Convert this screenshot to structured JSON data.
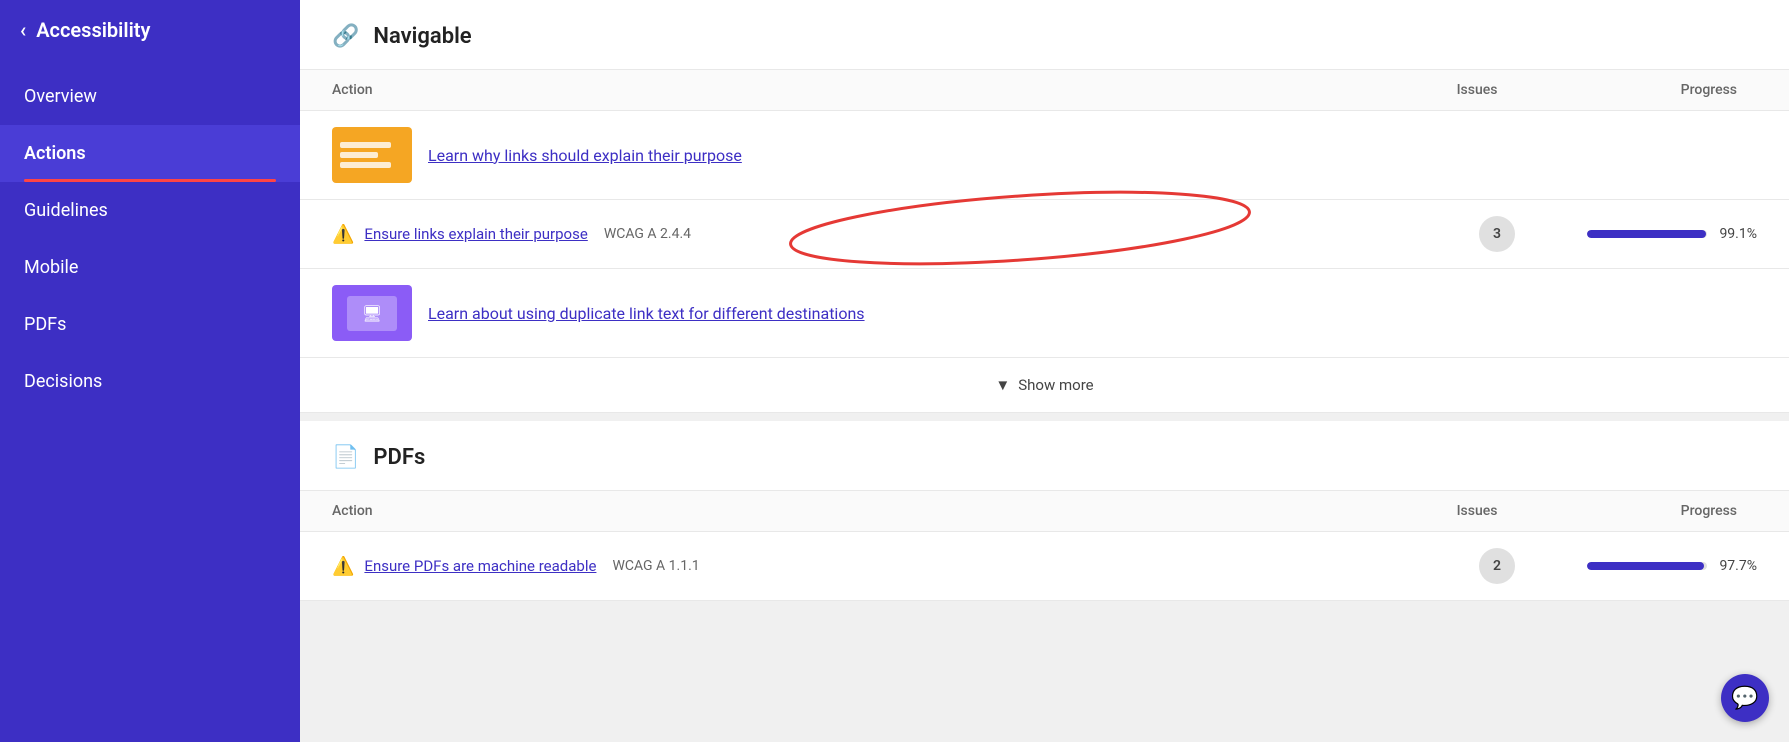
{
  "sidebar": {
    "title": "Accessibility",
    "back_label": "‹",
    "items": [
      {
        "id": "overview",
        "label": "Overview",
        "active": false
      },
      {
        "id": "actions",
        "label": "Actions",
        "active": true
      },
      {
        "id": "guidelines",
        "label": "Guidelines",
        "active": false
      },
      {
        "id": "mobile",
        "label": "Mobile",
        "active": false
      },
      {
        "id": "pdfs",
        "label": "PDFs",
        "active": false
      },
      {
        "id": "decisions",
        "label": "Decisions",
        "active": false
      }
    ]
  },
  "navigable_section": {
    "title": "Navigable",
    "icon": "link",
    "table_header": {
      "action_label": "Action",
      "issues_label": "Issues",
      "progress_label": "Progress"
    },
    "rows": [
      {
        "type": "action",
        "thumbnail_color": "orange",
        "link_text": "Learn why links should explain their purpose"
      },
      {
        "type": "issue",
        "warning": true,
        "link_text": "Ensure links explain their purpose",
        "wcag": "WCAG A 2.4.4",
        "issues_count": "3",
        "progress_pct": "99.1",
        "progress_fill": 99.1
      },
      {
        "type": "action",
        "thumbnail_color": "purple",
        "link_text": "Learn about using duplicate link text for different destinations"
      }
    ],
    "show_more_label": "Show more"
  },
  "pdfs_section": {
    "title": "PDFs",
    "icon": "pdf",
    "table_header": {
      "action_label": "Action",
      "issues_label": "Issues",
      "progress_label": "Progress"
    },
    "rows": [
      {
        "type": "issue",
        "warning": true,
        "link_text": "Ensure PDFs are machine readable",
        "wcag": "WCAG A 1.1.1",
        "issues_count": "2",
        "progress_pct": "97.7",
        "progress_fill": 97.7
      }
    ]
  },
  "annotations": {
    "arrow_label": "annotation arrow",
    "circle_label": "annotation circle"
  },
  "chat": {
    "icon_label": "💬"
  }
}
